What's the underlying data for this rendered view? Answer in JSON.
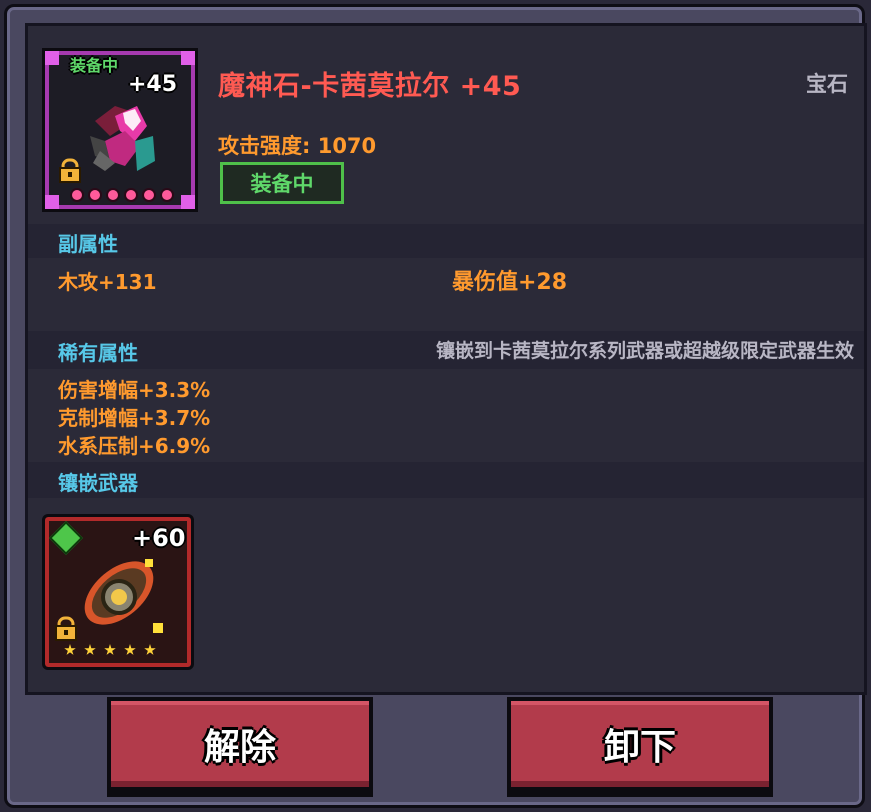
{
  "item": {
    "equip_tag": "装备中",
    "level": "+45",
    "name": "魔神石-卡茜莫拉尔 +45",
    "type": "宝石",
    "attack_label": "攻击强度: 1070",
    "equipped_badge": "装备中",
    "rarity_color": "#a63ab0",
    "star_count": 6
  },
  "sub_stats": {
    "title": "副属性",
    "items": [
      "木攻+131",
      "暴伤值+28"
    ]
  },
  "rare_stats": {
    "title": "稀有属性",
    "note": "镶嵌到卡茜莫拉尔系列武器或超越级限定武器生效",
    "items": [
      "伤害增幅+3.3%",
      "克制增幅+3.7%",
      "水系压制+6.9%"
    ]
  },
  "inlay": {
    "title": "镶嵌武器",
    "weapon_level": "+60",
    "star_count": 5
  },
  "buttons": {
    "unbind": "解除",
    "unequip": "卸下"
  },
  "colors": {
    "name": "#ff5a52",
    "stat": "#ff9a2e",
    "section": "#57c8e8",
    "equipped": "#5fd86a",
    "button": "#b23b4b"
  }
}
